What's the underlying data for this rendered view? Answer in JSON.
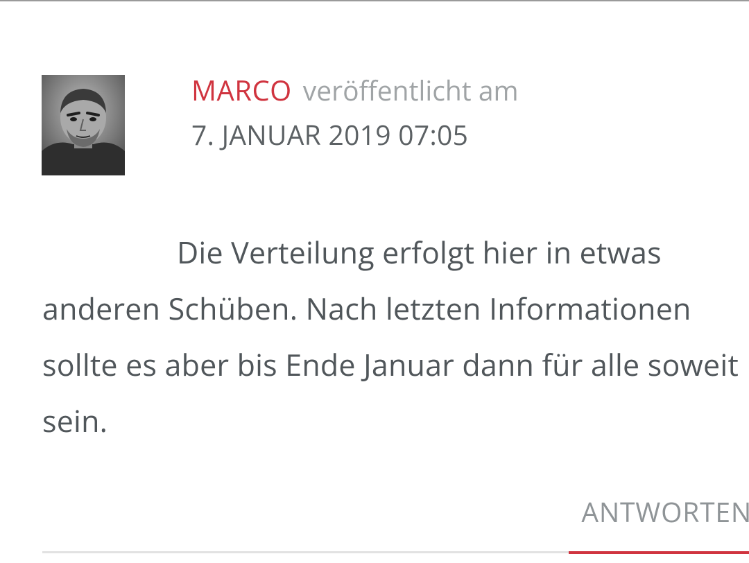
{
  "comment": {
    "author": "MARCO",
    "published_label": "veröffentlicht am",
    "date": "7. JANUAR 2019 07:05",
    "text": "Die Verteilung erfolgt hier in etwas anderen Schüben. Nach letzten Informationen sollte es aber bis Ende Januar dann für alle soweit sein.",
    "reply_label": "ANTWORTEN"
  },
  "colors": {
    "accent": "#d0343f",
    "text": "#545a5e",
    "muted": "#a0a4a6",
    "divider": "#e2e2e2"
  }
}
